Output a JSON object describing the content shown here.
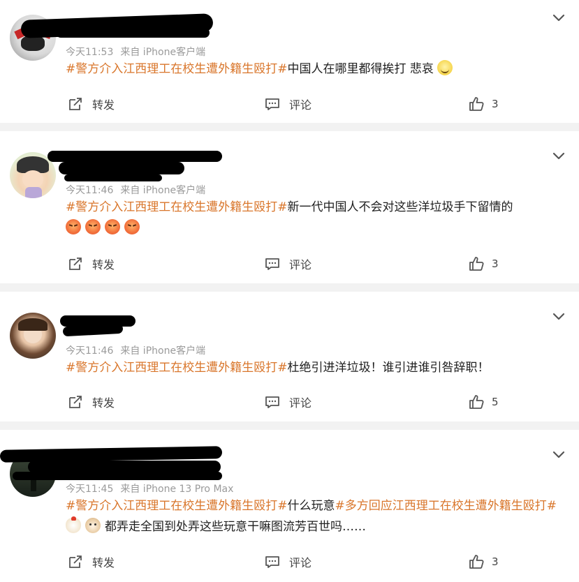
{
  "labels": {
    "forward": "转发",
    "comment": "评论"
  },
  "colors": {
    "tag": "#d9762b",
    "text": "#1f1f1f",
    "meta": "#9a9a9a",
    "divider": "#f2f2f2"
  },
  "posts": [
    {
      "time": "今天11:53",
      "source": "来自 iPhone客户端",
      "tag": "#警方介入江西理工在校生遭外籍生殴打#",
      "text": "中国人在哪里都得挨打 悲哀",
      "emojis": [
        "sad-smile-icon"
      ],
      "likes": "3"
    },
    {
      "time": "今天11:46",
      "source": "来自 iPhone客户端",
      "tag": "#警方介入江西理工在校生遭外籍生殴打#",
      "text": "新一代中国人不会对这些洋垃圾手下留情的",
      "emojis": [
        "angry-icon",
        "angry-icon",
        "angry-icon",
        "angry-icon"
      ],
      "likes": "3"
    },
    {
      "time": "今天11:46",
      "source": "来自 iPhone客户端",
      "tag": "#警方介入江西理工在校生遭外籍生殴打#",
      "text": "杜绝引进洋垃圾！谁引进谁引咎辞职！",
      "likes": "5"
    },
    {
      "time": "今天11:45",
      "source": "来自 iPhone 13 Pro Max",
      "tag": "#警方介入江西理工在校生遭外籍生殴打#",
      "text": "什么玩意",
      "tag2": "#多方回应江西理工在校生遭外籍生殴打#",
      "text2": "都弄走全国到处弄这些玩意干嘛图流芳百世吗……",
      "emojis": [
        "chicken-icon",
        "dog-icon"
      ],
      "likes": "3"
    }
  ]
}
